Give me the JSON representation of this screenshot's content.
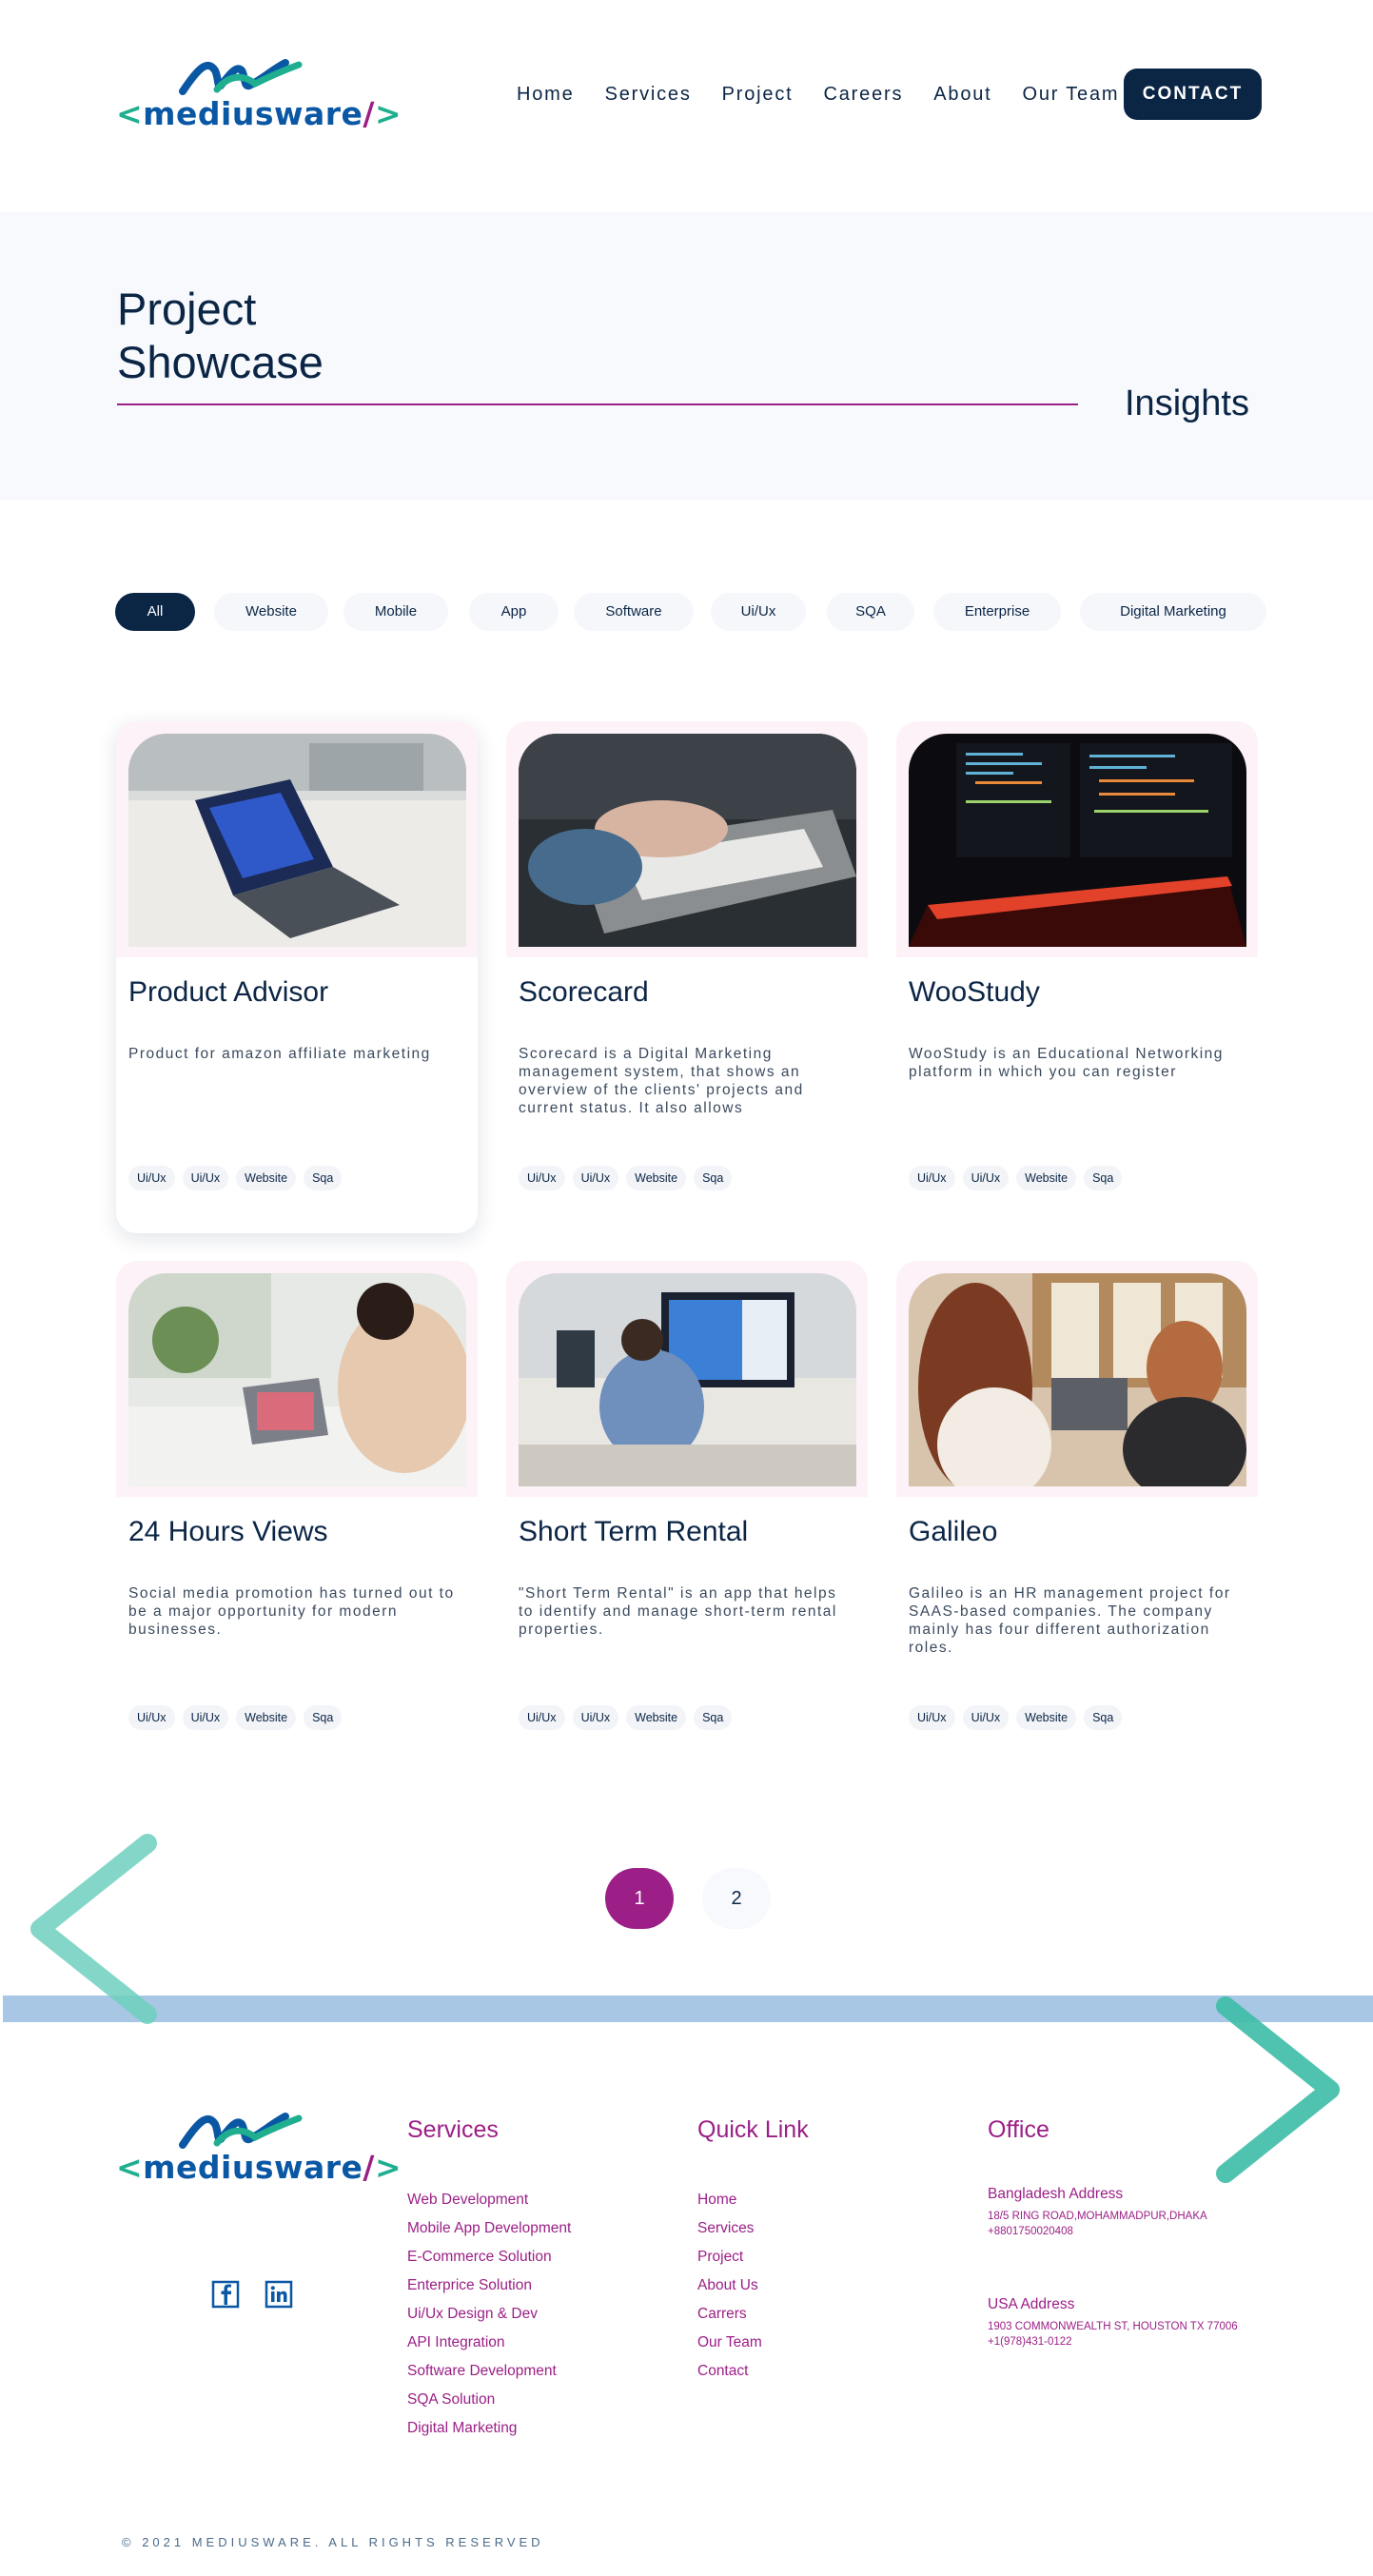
{
  "brand": {
    "logo_text_open": "<",
    "logo_text_word": "mediusware",
    "logo_text_slash": "/",
    "logo_text_close": ">",
    "colors": {
      "navy": "#0b2545",
      "magenta": "#9b1f86",
      "teal": "#1fae8f",
      "blue": "#0a57a4"
    }
  },
  "nav": {
    "items": [
      "Home",
      "Services",
      "Project",
      "Careers",
      "About",
      "Our Team"
    ],
    "contact_label": "CONTACT"
  },
  "hero": {
    "title_line1": "Project",
    "title_line2": "Showcase",
    "right_label": "Insights"
  },
  "filters": {
    "items": [
      "All",
      "Website",
      "Mobile",
      "App",
      "Software",
      "Ui/Ux",
      "SQA",
      "Enterprise",
      "Digital Marketing"
    ],
    "active": "All"
  },
  "projects": [
    {
      "title": "Product Advisor",
      "description": "Product for amazon affiliate marketing",
      "tags": [
        "Ui/Ux",
        "Ui/Ux",
        "Website",
        "Sqa"
      ],
      "image_icon": "laptop-photo"
    },
    {
      "title": "Scorecard",
      "description": "Scorecard is a Digital Marketing management system, that shows an overview of the clients' projects and current status. It also allows",
      "tags": [
        "Ui/Ux",
        "Ui/Ux",
        "Website",
        "Sqa"
      ],
      "image_icon": "keyboard-typing-photo"
    },
    {
      "title": "WooStudy",
      "description": "WooStudy is an Educational Networking platform in which you can register",
      "tags": [
        "Ui/Ux",
        "Ui/Ux",
        "Website",
        "Sqa"
      ],
      "image_icon": "code-screen-photo"
    },
    {
      "title": "24 Hours Views",
      "description": "Social media promotion has turned out to be a major opportunity for modern businesses.",
      "tags": [
        "Ui/Ux",
        "Ui/Ux",
        "Website",
        "Sqa"
      ],
      "image_icon": "woman-laptop-photo"
    },
    {
      "title": "Short Term Rental",
      "description": "\"Short Term Rental\" is an app that helps to identify and manage short-term rental properties.",
      "tags": [
        "Ui/Ux",
        "Ui/Ux",
        "Website",
        "Sqa"
      ],
      "image_icon": "man-desk-photo"
    },
    {
      "title": "Galileo",
      "description": "Galileo is an HR management project for SAAS-based companies. The company mainly has four different authorization roles.",
      "tags": [
        "Ui/Ux",
        "Ui/Ux",
        "Website",
        "Sqa"
      ],
      "image_icon": "two-women-laptop-photo"
    }
  ],
  "pagination": {
    "pages": [
      "1",
      "2"
    ],
    "current": "1"
  },
  "footer": {
    "services": {
      "heading": "Services",
      "links": [
        "Web Development",
        "Mobile App Development",
        "E-Commerce Solution",
        "Enterprice Solution",
        "Ui/Ux Design & Dev",
        "API Integration",
        "Software Development",
        "SQA Solution",
        "Digital Marketing"
      ]
    },
    "quick": {
      "heading": "Quick Link",
      "links": [
        "Home",
        "Services",
        "Project",
        "About Us",
        "Carrers",
        "Our Team",
        "Contact"
      ]
    },
    "office": {
      "heading": "Office",
      "bd_heading": "Bangladesh Address",
      "bd_line1": "18/5 RING ROAD,MOHAMMADPUR,DHAKA",
      "bd_line2": "+8801750020408",
      "us_heading": "USA Address",
      "us_line1": "1903 COMMONWEALTH ST, HOUSTON TX 77006",
      "us_line2": "+1(978)431-0122"
    },
    "social": [
      "facebook-icon",
      "linkedin-icon"
    ],
    "copyright": "© 2021 MEDIUSWARE. ALL RIGHTS RESERVED"
  }
}
